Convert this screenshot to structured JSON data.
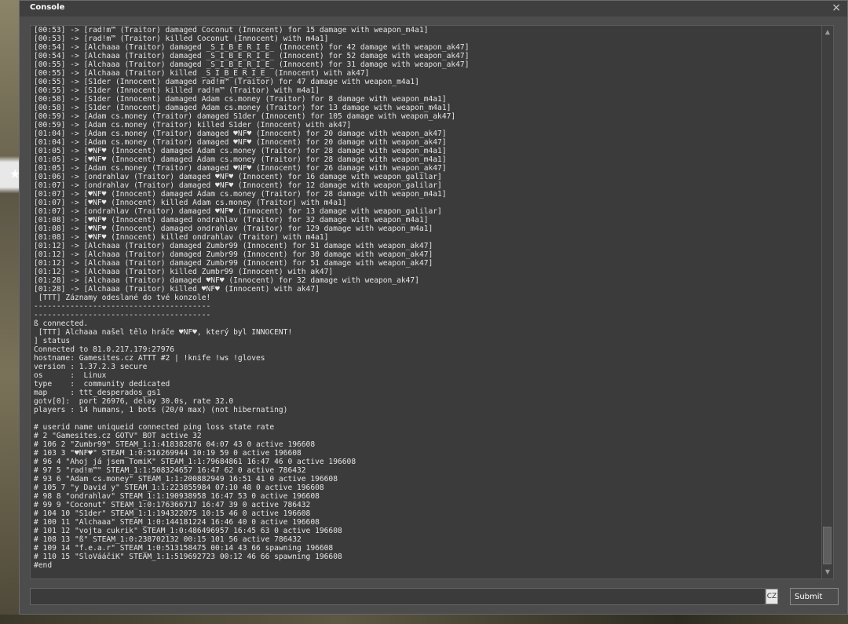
{
  "window": {
    "title": "Console",
    "close_glyph": "×"
  },
  "input": {
    "value": "",
    "language": "CZ"
  },
  "submit_label": "Submit",
  "log_lines": [
    "[00:53] -> [rad!m™ (Traitor) damaged Coconut (Innocent) for 15 damage with weapon_m4a1]",
    "[00:53] -> [rad!m™ (Traitor) killed Coconut (Innocent) with m4a1]",
    "[00:54] -> [Alchaaa (Traitor) damaged _S_I_B_E_R_I_E_ (Innocent) for 42 damage with weapon_ak47]",
    "[00:54] -> [Alchaaa (Traitor) damaged _S_I_B_E_R_I_E_ (Innocent) for 52 damage with weapon_ak47]",
    "[00:55] -> [Alchaaa (Traitor) damaged _S_I_B_E_R_I_E_ (Innocent) for 31 damage with weapon_ak47]",
    "[00:55] -> [Alchaaa (Traitor) killed _S_I_B_E_R_I_E_ (Innocent) with ak47]",
    "[00:55] -> [S1der (Innocent) damaged rad!m™ (Traitor) for 47 damage with weapon_m4a1]",
    "[00:55] -> [S1der (Innocent) killed rad!m™ (Traitor) with m4a1]",
    "[00:58] -> [S1der (Innocent) damaged Adam cs.money (Traitor) for 8 damage with weapon_m4a1]",
    "[00:58] -> [S1der (Innocent) damaged Adam cs.money (Traitor) for 13 damage with weapon_m4a1]",
    "[00:59] -> [Adam cs.money (Traitor) damaged S1der (Innocent) for 105 damage with weapon_ak47]",
    "[00:59] -> [Adam cs.money (Traitor) killed S1der (Innocent) with ak47]",
    "[01:04] -> [Adam cs.money (Traitor) damaged ♥NF♥ (Innocent) for 20 damage with weapon_ak47]",
    "[01:04] -> [Adam cs.money (Traitor) damaged ♥NF♥ (Innocent) for 20 damage with weapon_ak47]",
    "[01:05] -> [♥NF♥ (Innocent) damaged Adam cs.money (Traitor) for 28 damage with weapon_m4a1]",
    "[01:05] -> [♥NF♥ (Innocent) damaged Adam cs.money (Traitor) for 28 damage with weapon_m4a1]",
    "[01:05] -> [Adam cs.money (Traitor) damaged ♥NF♥ (Innocent) for 26 damage with weapon_ak47]",
    "[01:06] -> [ondrahlav (Traitor) damaged ♥NF♥ (Innocent) for 16 damage with weapon_galilar]",
    "[01:07] -> [ondrahlav (Traitor) damaged ♥NF♥ (Innocent) for 12 damage with weapon_galilar]",
    "[01:07] -> [♥NF♥ (Innocent) damaged Adam cs.money (Traitor) for 28 damage with weapon_m4a1]",
    "[01:07] -> [♥NF♥ (Innocent) killed Adam cs.money (Traitor) with m4a1]",
    "[01:07] -> [ondrahlav (Traitor) damaged ♥NF♥ (Innocent) for 13 damage with weapon_galilar]",
    "[01:08] -> [♥NF♥ (Innocent) damaged ondrahlav (Traitor) for 32 damage with weapon_m4a1]",
    "[01:08] -> [♥NF♥ (Innocent) damaged ondrahlav (Traitor) for 129 damage with weapon_m4a1]",
    "[01:08] -> [♥NF♥ (Innocent) killed ondrahlav (Traitor) with m4a1]",
    "[01:12] -> [Alchaaa (Traitor) damaged Zumbr99 (Innocent) for 51 damage with weapon_ak47]",
    "[01:12] -> [Alchaaa (Traitor) damaged Zumbr99 (Innocent) for 30 damage with weapon_ak47]",
    "[01:12] -> [Alchaaa (Traitor) damaged Zumbr99 (Innocent) for 51 damage with weapon_ak47]",
    "[01:12] -> [Alchaaa (Traitor) killed Zumbr99 (Innocent) with ak47]",
    "[01:28] -> [Alchaaa (Traitor) damaged ♥NF♥ (Innocent) for 32 damage with weapon_ak47]",
    "[01:28] -> [Alchaaa (Traitor) killed ♥NF♥ (Innocent) with ak47]",
    " [TTT] Záznamy odeslané do tvé konzole!",
    "---------------------------------------",
    "---------------------------------------",
    "ß connected.",
    " [TTT] Alchaaa našel tělo hráče ♥NF♥, který byl INNOCENT!",
    "] status",
    "Connected to 81.0.217.179:27976",
    "hostname: Gamesites.cz ATTT #2 | !knife !ws !gloves",
    "version : 1.37.2.3 secure",
    "os      :  Linux",
    "type    :  community dedicated",
    "map     : ttt_desperados_gs1",
    "gotv[0]:  port 26976, delay 30.0s, rate 32.0",
    "players : 14 humans, 1 bots (20/0 max) (not hibernating)",
    "",
    "# userid name uniqueid connected ping loss state rate",
    "# 2 \"Gamesites.cz GOTV\" BOT active 32",
    "# 106 2 \"Zumbr99\" STEAM_1:1:418382876 04:07 43 0 active 196608",
    "# 103 3 \"♥NF♥\" STEAM_1:0:516269944 10:19 59 0 active 196608",
    "# 96 4 \"Ahoj já jsem TomiK\" STEAM_1:1:79684861 16:47 46 0 active 196608",
    "# 97 5 \"rad!m™\" STEAM_1:1:508324657 16:47 62 0 active 786432",
    "# 93 6 \"Adam cs.money\" STEAM_1:1:200882949 16:51 41 0 active 196608",
    "# 105 7 \"y David y\" STEAM_1:1:223855984 07:10 48 0 active 196608",
    "# 98 8 \"ondrahlav\" STEAM_1:1:190938958 16:47 53 0 active 196608",
    "# 99 9 \"Coconut\" STEAM_1:0:176366717 16:47 39 0 active 786432",
    "# 104 10 \"S1der\" STEAM_1:1:194322075 10:15 46 0 active 196608",
    "# 100 11 \"Alchaaa\" STEAM_1:0:144181224 16:46 40 0 active 196608",
    "# 101 12 \"vojta cukrik\" STEAM_1:0:486496957 16:45 63 0 active 196608",
    "# 108 13 \"ß\" STEAM_1:0:238702132 00:15 101 56 active 786432",
    "# 109 14 \"f.e.a.r\" STEAM_1:0:513158475 00:14 43 66 spawning 196608",
    "# 110 15 \"SloVááčiK\" STEAM_1:1:519692723 00:12 46 66 spawning 196608",
    "#end"
  ]
}
